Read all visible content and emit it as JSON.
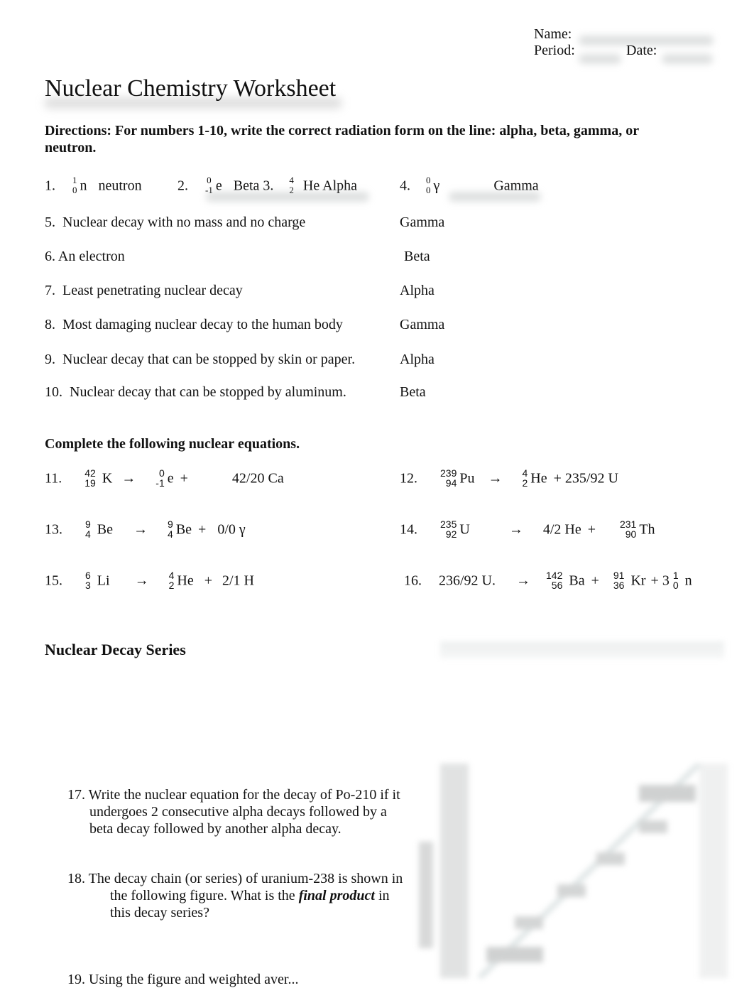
{
  "header": {
    "name_label": "Name:",
    "period_label": "Period:",
    "date_label": "Date:"
  },
  "title": "Nuclear Chemistry Worksheet",
  "directions": {
    "text": "Directions:  For numbers 1-10, write the correct radiation form on the line: alpha, beta, gamma, or neutron."
  },
  "symbols_row": [
    {
      "num": "1.",
      "mass": "1",
      "atomic": "0",
      "symbol": "n",
      "answer": "neutron"
    },
    {
      "num": "2.",
      "mass": "0",
      "atomic": "-1",
      "symbol": "e",
      "answer": "Beta"
    },
    {
      "num": "3.",
      "mass": "4",
      "atomic": "2",
      "symbol": "He",
      "answer": "Alpha"
    },
    {
      "num": "4.",
      "mass": "0",
      "atomic": "0",
      "symbol": "γ",
      "answer": "Gamma"
    }
  ],
  "questions": [
    {
      "num": "5.",
      "text": "Nuclear decay with no mass and no charge",
      "answer": "Gamma"
    },
    {
      "num": "6.",
      "text": "An electron",
      "answer": "Beta"
    },
    {
      "num": "7.",
      "text": "Least penetrating nuclear decay",
      "answer": "Alpha"
    },
    {
      "num": "8.",
      "text": "Most damaging nuclear decay to the human body",
      "answer": "Gamma"
    },
    {
      "num": "9.",
      "text": "Nuclear decay that can be stopped by skin or paper.",
      "answer": "Alpha"
    },
    {
      "num": "10.",
      "text": "Nuclear decay that can be stopped by aluminum.",
      "answer": "Beta"
    }
  ],
  "equations_heading": "Complete the following nuclear equations.",
  "equations": {
    "e11": {
      "num": "11.",
      "r_mass": "42",
      "r_atomic": "19",
      "r_sym": "K",
      "arrow": "→",
      "p1_mass": "0",
      "p1_atomic": "-1",
      "p1_sym": "e",
      "plus": "+",
      "answer": "42/20 Ca"
    },
    "e12": {
      "num": "12.",
      "r_mass": "239",
      "r_atomic": "94",
      "r_sym": "Pu",
      "arrow": "→",
      "p1_mass": "4",
      "p1_atomic": "2",
      "p1_sym": "He",
      "plus": "+",
      "answer": "235/92 U"
    },
    "e13": {
      "num": "13.",
      "r_mass": "9",
      "r_atomic": "4",
      "r_sym": "Be",
      "arrow": "→",
      "p1_mass": "9",
      "p1_atomic": "4",
      "p1_sym": "Be",
      "plus": "+",
      "answer": "0/0 γ"
    },
    "e14": {
      "num": "14.",
      "r_mass": "235",
      "r_atomic": "92",
      "r_sym": "U",
      "arrow": "→",
      "answer": "4/2 He",
      "plus": "+",
      "p2_mass": "231",
      "p2_atomic": "90",
      "p2_sym": "Th"
    },
    "e15": {
      "num": "15.",
      "r_mass": "6",
      "r_atomic": "3",
      "r_sym": "Li",
      "arrow": "→",
      "p1_mass": "4",
      "p1_atomic": "2",
      "p1_sym": "He",
      "plus": "+",
      "answer": "2/1 H"
    },
    "e16": {
      "num": "16.",
      "answer": "236/92 U.",
      "arrow": "→",
      "p1_mass": "142",
      "p1_atomic": "56",
      "p1_sym": "Ba",
      "plus": "+",
      "p2_mass": "91",
      "p2_atomic": "36",
      "p2_sym": "Kr",
      "plus2": "+",
      "coef": "3",
      "p3_mass": "1",
      "p3_atomic": "0",
      "p3_sym": "n"
    }
  },
  "decay_series": {
    "heading": "Nuclear Decay Series",
    "q17": "17. Write the nuclear equation for the decay of Po-210 if it undergoes 2 consecutive alpha decays followed by a beta decay followed by another alpha decay.",
    "q18_pre": "18. The decay chain (or series) of uranium-238 is shown in the following figure.  What is the ",
    "q18_bold": "final product",
    "q18_post": " in this decay series?",
    "q19_partial": "19. Using the figure and weighted aver..."
  }
}
